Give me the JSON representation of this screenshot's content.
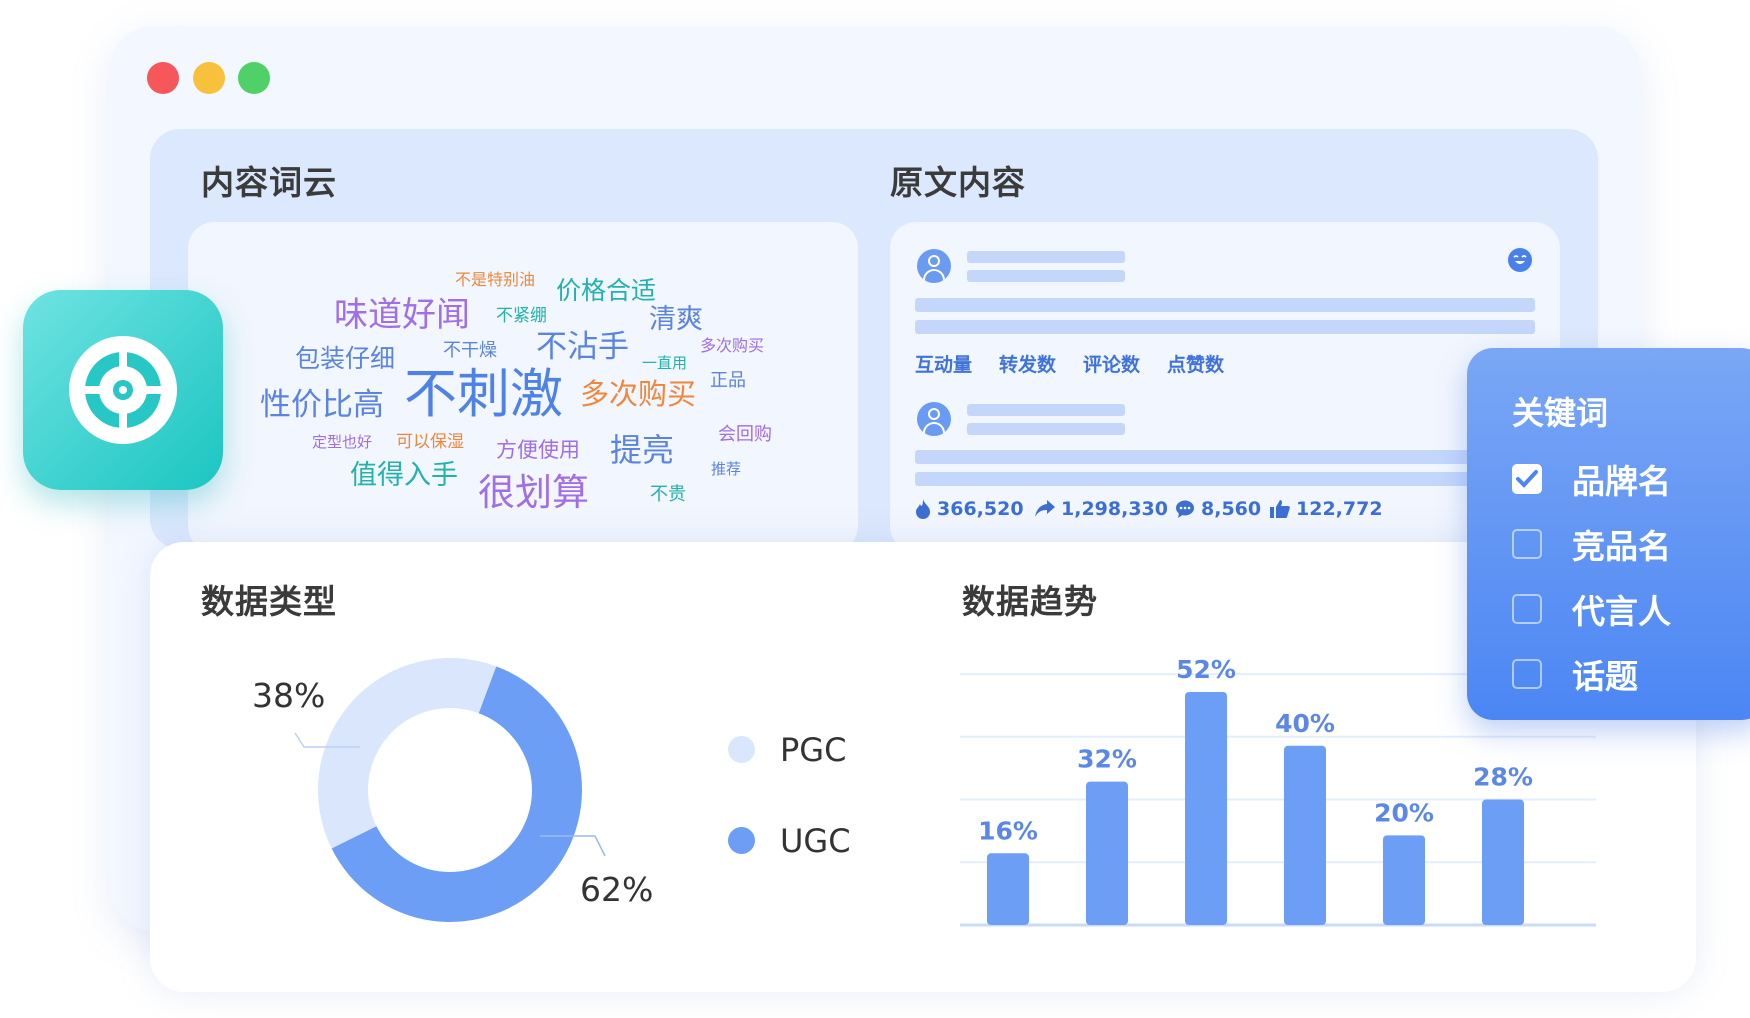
{
  "window": {
    "controls": [
      "close",
      "minimize",
      "maximize"
    ]
  },
  "wordcloud": {
    "title": "内容词云",
    "words": [
      {
        "text": "不是特别油",
        "color": "#f0873b"
      },
      {
        "text": "价格合适",
        "color": "#22b1ad"
      },
      {
        "text": "味道好闻",
        "color": "#a06ee6"
      },
      {
        "text": "不紧绷",
        "color": "#22b1ad"
      },
      {
        "text": "清爽",
        "color": "#5a84e0"
      },
      {
        "text": "包装仔细",
        "color": "#5a84e0"
      },
      {
        "text": "不干燥",
        "color": "#5a84e0"
      },
      {
        "text": "不沾手",
        "color": "#5a84e0"
      },
      {
        "text": "多次购买",
        "color": "#a06ee6"
      },
      {
        "text": "一直用",
        "color": "#22b1ad"
      },
      {
        "text": "性价比高",
        "color": "#5a84e0"
      },
      {
        "text": "不刺激",
        "color": "#4f82e6"
      },
      {
        "text": "多次购买",
        "color": "#f0873b"
      },
      {
        "text": "正品",
        "color": "#5a84e0"
      },
      {
        "text": "定型也好",
        "color": "#a06ee6"
      },
      {
        "text": "可以保湿",
        "color": "#f0873b"
      },
      {
        "text": "方便使用",
        "color": "#a06ee6"
      },
      {
        "text": "提亮",
        "color": "#5a84e0"
      },
      {
        "text": "会回购",
        "color": "#a06ee6"
      },
      {
        "text": "值得入手",
        "color": "#22b1ad"
      },
      {
        "text": "很划算",
        "color": "#a06ee6"
      },
      {
        "text": "推荐",
        "color": "#5a84e0"
      },
      {
        "text": "不贵",
        "color": "#22b1ad"
      }
    ]
  },
  "content": {
    "title": "原文内容",
    "metrics": [
      "互动量",
      "转发数",
      "评论数",
      "点赞数"
    ],
    "stats": [
      {
        "icon": "fire-icon",
        "value": "366,520"
      },
      {
        "icon": "share-icon",
        "value": "1,298,330"
      },
      {
        "icon": "comment-icon",
        "value": "8,560"
      },
      {
        "icon": "thumbs-up-icon",
        "value": "122,772"
      }
    ]
  },
  "data_type": {
    "title": "数据类型",
    "labels": {
      "pgc_pct": "38%",
      "ugc_pct": "62%"
    },
    "legend": {
      "pgc": "PGC",
      "ugc": "UGC"
    }
  },
  "trend": {
    "title": "数据趋势",
    "value_labels": [
      "16%",
      "32%",
      "52%",
      "40%",
      "20%",
      "28%"
    ]
  },
  "keywords": {
    "title": "关键词",
    "items": [
      {
        "label": "品牌名",
        "checked": true
      },
      {
        "label": "竞品名",
        "checked": false
      },
      {
        "label": "代言人",
        "checked": false
      },
      {
        "label": "话题",
        "checked": false
      }
    ]
  },
  "colors": {
    "accent": "#4c86f4",
    "ugc": "#6d9ef5",
    "pgc": "#d9e6fc",
    "teal": "#1bc5c1"
  },
  "chart_data": [
    {
      "type": "pie",
      "title": "数据类型",
      "categories": [
        "PGC",
        "UGC"
      ],
      "values": [
        38,
        62
      ],
      "colors": [
        "#d9e6fc",
        "#6d9ef5"
      ],
      "legend": "right"
    },
    {
      "type": "bar",
      "title": "数据趋势",
      "categories": [
        "",
        "",
        "",
        "",
        "",
        ""
      ],
      "values": [
        16,
        32,
        52,
        40,
        20,
        28
      ],
      "ylim": [
        0,
        60
      ],
      "grid": true
    }
  ]
}
